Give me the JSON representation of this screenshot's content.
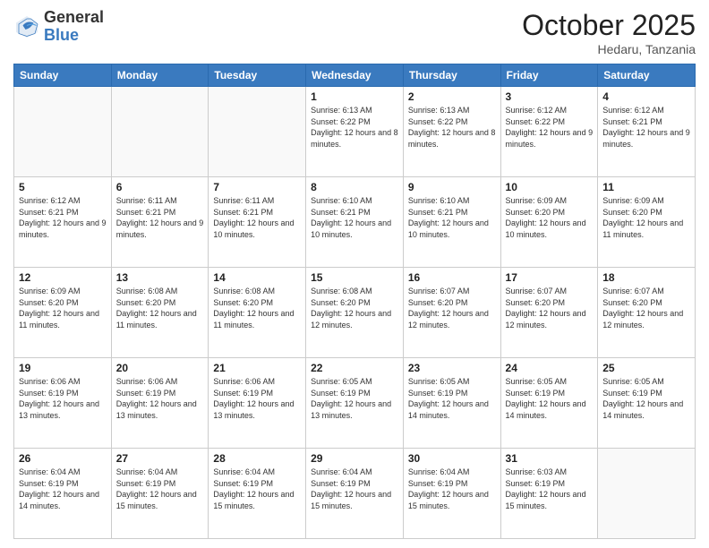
{
  "header": {
    "logo_general": "General",
    "logo_blue": "Blue",
    "month_title": "October 2025",
    "location": "Hedaru, Tanzania"
  },
  "weekdays": [
    "Sunday",
    "Monday",
    "Tuesday",
    "Wednesday",
    "Thursday",
    "Friday",
    "Saturday"
  ],
  "weeks": [
    [
      {
        "day": "",
        "sunrise": "",
        "sunset": "",
        "daylight": ""
      },
      {
        "day": "",
        "sunrise": "",
        "sunset": "",
        "daylight": ""
      },
      {
        "day": "",
        "sunrise": "",
        "sunset": "",
        "daylight": ""
      },
      {
        "day": "1",
        "sunrise": "Sunrise: 6:13 AM",
        "sunset": "Sunset: 6:22 PM",
        "daylight": "Daylight: 12 hours and 8 minutes."
      },
      {
        "day": "2",
        "sunrise": "Sunrise: 6:13 AM",
        "sunset": "Sunset: 6:22 PM",
        "daylight": "Daylight: 12 hours and 8 minutes."
      },
      {
        "day": "3",
        "sunrise": "Sunrise: 6:12 AM",
        "sunset": "Sunset: 6:22 PM",
        "daylight": "Daylight: 12 hours and 9 minutes."
      },
      {
        "day": "4",
        "sunrise": "Sunrise: 6:12 AM",
        "sunset": "Sunset: 6:21 PM",
        "daylight": "Daylight: 12 hours and 9 minutes."
      }
    ],
    [
      {
        "day": "5",
        "sunrise": "Sunrise: 6:12 AM",
        "sunset": "Sunset: 6:21 PM",
        "daylight": "Daylight: 12 hours and 9 minutes."
      },
      {
        "day": "6",
        "sunrise": "Sunrise: 6:11 AM",
        "sunset": "Sunset: 6:21 PM",
        "daylight": "Daylight: 12 hours and 9 minutes."
      },
      {
        "day": "7",
        "sunrise": "Sunrise: 6:11 AM",
        "sunset": "Sunset: 6:21 PM",
        "daylight": "Daylight: 12 hours and 10 minutes."
      },
      {
        "day": "8",
        "sunrise": "Sunrise: 6:10 AM",
        "sunset": "Sunset: 6:21 PM",
        "daylight": "Daylight: 12 hours and 10 minutes."
      },
      {
        "day": "9",
        "sunrise": "Sunrise: 6:10 AM",
        "sunset": "Sunset: 6:21 PM",
        "daylight": "Daylight: 12 hours and 10 minutes."
      },
      {
        "day": "10",
        "sunrise": "Sunrise: 6:09 AM",
        "sunset": "Sunset: 6:20 PM",
        "daylight": "Daylight: 12 hours and 10 minutes."
      },
      {
        "day": "11",
        "sunrise": "Sunrise: 6:09 AM",
        "sunset": "Sunset: 6:20 PM",
        "daylight": "Daylight: 12 hours and 11 minutes."
      }
    ],
    [
      {
        "day": "12",
        "sunrise": "Sunrise: 6:09 AM",
        "sunset": "Sunset: 6:20 PM",
        "daylight": "Daylight: 12 hours and 11 minutes."
      },
      {
        "day": "13",
        "sunrise": "Sunrise: 6:08 AM",
        "sunset": "Sunset: 6:20 PM",
        "daylight": "Daylight: 12 hours and 11 minutes."
      },
      {
        "day": "14",
        "sunrise": "Sunrise: 6:08 AM",
        "sunset": "Sunset: 6:20 PM",
        "daylight": "Daylight: 12 hours and 11 minutes."
      },
      {
        "day": "15",
        "sunrise": "Sunrise: 6:08 AM",
        "sunset": "Sunset: 6:20 PM",
        "daylight": "Daylight: 12 hours and 12 minutes."
      },
      {
        "day": "16",
        "sunrise": "Sunrise: 6:07 AM",
        "sunset": "Sunset: 6:20 PM",
        "daylight": "Daylight: 12 hours and 12 minutes."
      },
      {
        "day": "17",
        "sunrise": "Sunrise: 6:07 AM",
        "sunset": "Sunset: 6:20 PM",
        "daylight": "Daylight: 12 hours and 12 minutes."
      },
      {
        "day": "18",
        "sunrise": "Sunrise: 6:07 AM",
        "sunset": "Sunset: 6:20 PM",
        "daylight": "Daylight: 12 hours and 12 minutes."
      }
    ],
    [
      {
        "day": "19",
        "sunrise": "Sunrise: 6:06 AM",
        "sunset": "Sunset: 6:19 PM",
        "daylight": "Daylight: 12 hours and 13 minutes."
      },
      {
        "day": "20",
        "sunrise": "Sunrise: 6:06 AM",
        "sunset": "Sunset: 6:19 PM",
        "daylight": "Daylight: 12 hours and 13 minutes."
      },
      {
        "day": "21",
        "sunrise": "Sunrise: 6:06 AM",
        "sunset": "Sunset: 6:19 PM",
        "daylight": "Daylight: 12 hours and 13 minutes."
      },
      {
        "day": "22",
        "sunrise": "Sunrise: 6:05 AM",
        "sunset": "Sunset: 6:19 PM",
        "daylight": "Daylight: 12 hours and 13 minutes."
      },
      {
        "day": "23",
        "sunrise": "Sunrise: 6:05 AM",
        "sunset": "Sunset: 6:19 PM",
        "daylight": "Daylight: 12 hours and 14 minutes."
      },
      {
        "day": "24",
        "sunrise": "Sunrise: 6:05 AM",
        "sunset": "Sunset: 6:19 PM",
        "daylight": "Daylight: 12 hours and 14 minutes."
      },
      {
        "day": "25",
        "sunrise": "Sunrise: 6:05 AM",
        "sunset": "Sunset: 6:19 PM",
        "daylight": "Daylight: 12 hours and 14 minutes."
      }
    ],
    [
      {
        "day": "26",
        "sunrise": "Sunrise: 6:04 AM",
        "sunset": "Sunset: 6:19 PM",
        "daylight": "Daylight: 12 hours and 14 minutes."
      },
      {
        "day": "27",
        "sunrise": "Sunrise: 6:04 AM",
        "sunset": "Sunset: 6:19 PM",
        "daylight": "Daylight: 12 hours and 15 minutes."
      },
      {
        "day": "28",
        "sunrise": "Sunrise: 6:04 AM",
        "sunset": "Sunset: 6:19 PM",
        "daylight": "Daylight: 12 hours and 15 minutes."
      },
      {
        "day": "29",
        "sunrise": "Sunrise: 6:04 AM",
        "sunset": "Sunset: 6:19 PM",
        "daylight": "Daylight: 12 hours and 15 minutes."
      },
      {
        "day": "30",
        "sunrise": "Sunrise: 6:04 AM",
        "sunset": "Sunset: 6:19 PM",
        "daylight": "Daylight: 12 hours and 15 minutes."
      },
      {
        "day": "31",
        "sunrise": "Sunrise: 6:03 AM",
        "sunset": "Sunset: 6:19 PM",
        "daylight": "Daylight: 12 hours and 15 minutes."
      },
      {
        "day": "",
        "sunrise": "",
        "sunset": "",
        "daylight": ""
      }
    ]
  ]
}
